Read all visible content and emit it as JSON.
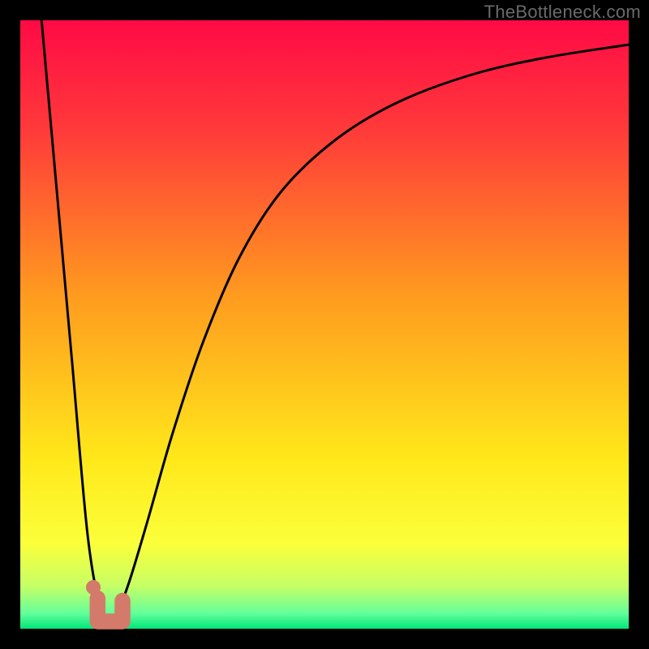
{
  "watermark": "TheBottleneck.com",
  "chart_data": {
    "type": "line",
    "title": "",
    "xlabel": "",
    "ylabel": "",
    "xlim": [
      0,
      100
    ],
    "ylim": [
      0,
      100
    ],
    "grid": false,
    "legend": false,
    "background_gradient_stops": [
      {
        "offset": 0.0,
        "color": "#ff0a45"
      },
      {
        "offset": 0.18,
        "color": "#ff3a3a"
      },
      {
        "offset": 0.45,
        "color": "#ff9a1f"
      },
      {
        "offset": 0.72,
        "color": "#ffe81a"
      },
      {
        "offset": 0.86,
        "color": "#fbff3a"
      },
      {
        "offset": 0.93,
        "color": "#c6ff66"
      },
      {
        "offset": 0.975,
        "color": "#63ff9a"
      },
      {
        "offset": 1.0,
        "color": "#00e67a"
      }
    ],
    "series": [
      {
        "name": "bottleneck-curve",
        "stroke": "#000000",
        "stroke_width": 3,
        "points": [
          {
            "x": 3.5,
            "y": 100.0
          },
          {
            "x": 6.0,
            "y": 72.0
          },
          {
            "x": 8.5,
            "y": 44.0
          },
          {
            "x": 11.0,
            "y": 16.0
          },
          {
            "x": 13.0,
            "y": 4.0
          },
          {
            "x": 14.5,
            "y": 1.0
          },
          {
            "x": 16.0,
            "y": 2.8
          },
          {
            "x": 18.0,
            "y": 8.0
          },
          {
            "x": 21.0,
            "y": 18.0
          },
          {
            "x": 25.0,
            "y": 32.0
          },
          {
            "x": 30.0,
            "y": 47.0
          },
          {
            "x": 36.0,
            "y": 61.0
          },
          {
            "x": 43.0,
            "y": 72.0
          },
          {
            "x": 52.0,
            "y": 80.5
          },
          {
            "x": 62.0,
            "y": 86.5
          },
          {
            "x": 74.0,
            "y": 91.0
          },
          {
            "x": 86.0,
            "y": 93.8
          },
          {
            "x": 100.0,
            "y": 96.0
          }
        ]
      }
    ],
    "marker": {
      "name": "sweet-spot-marker",
      "color": "#d47a6a",
      "dot": {
        "x": 12.0,
        "y": 6.8,
        "r_pct": 1.2
      },
      "hook": [
        {
          "x": 12.7,
          "y": 5.0
        },
        {
          "x": 12.7,
          "y": 1.2
        },
        {
          "x": 16.8,
          "y": 1.2
        },
        {
          "x": 16.8,
          "y": 4.6
        }
      ],
      "hook_width_pct": 2.6
    }
  }
}
